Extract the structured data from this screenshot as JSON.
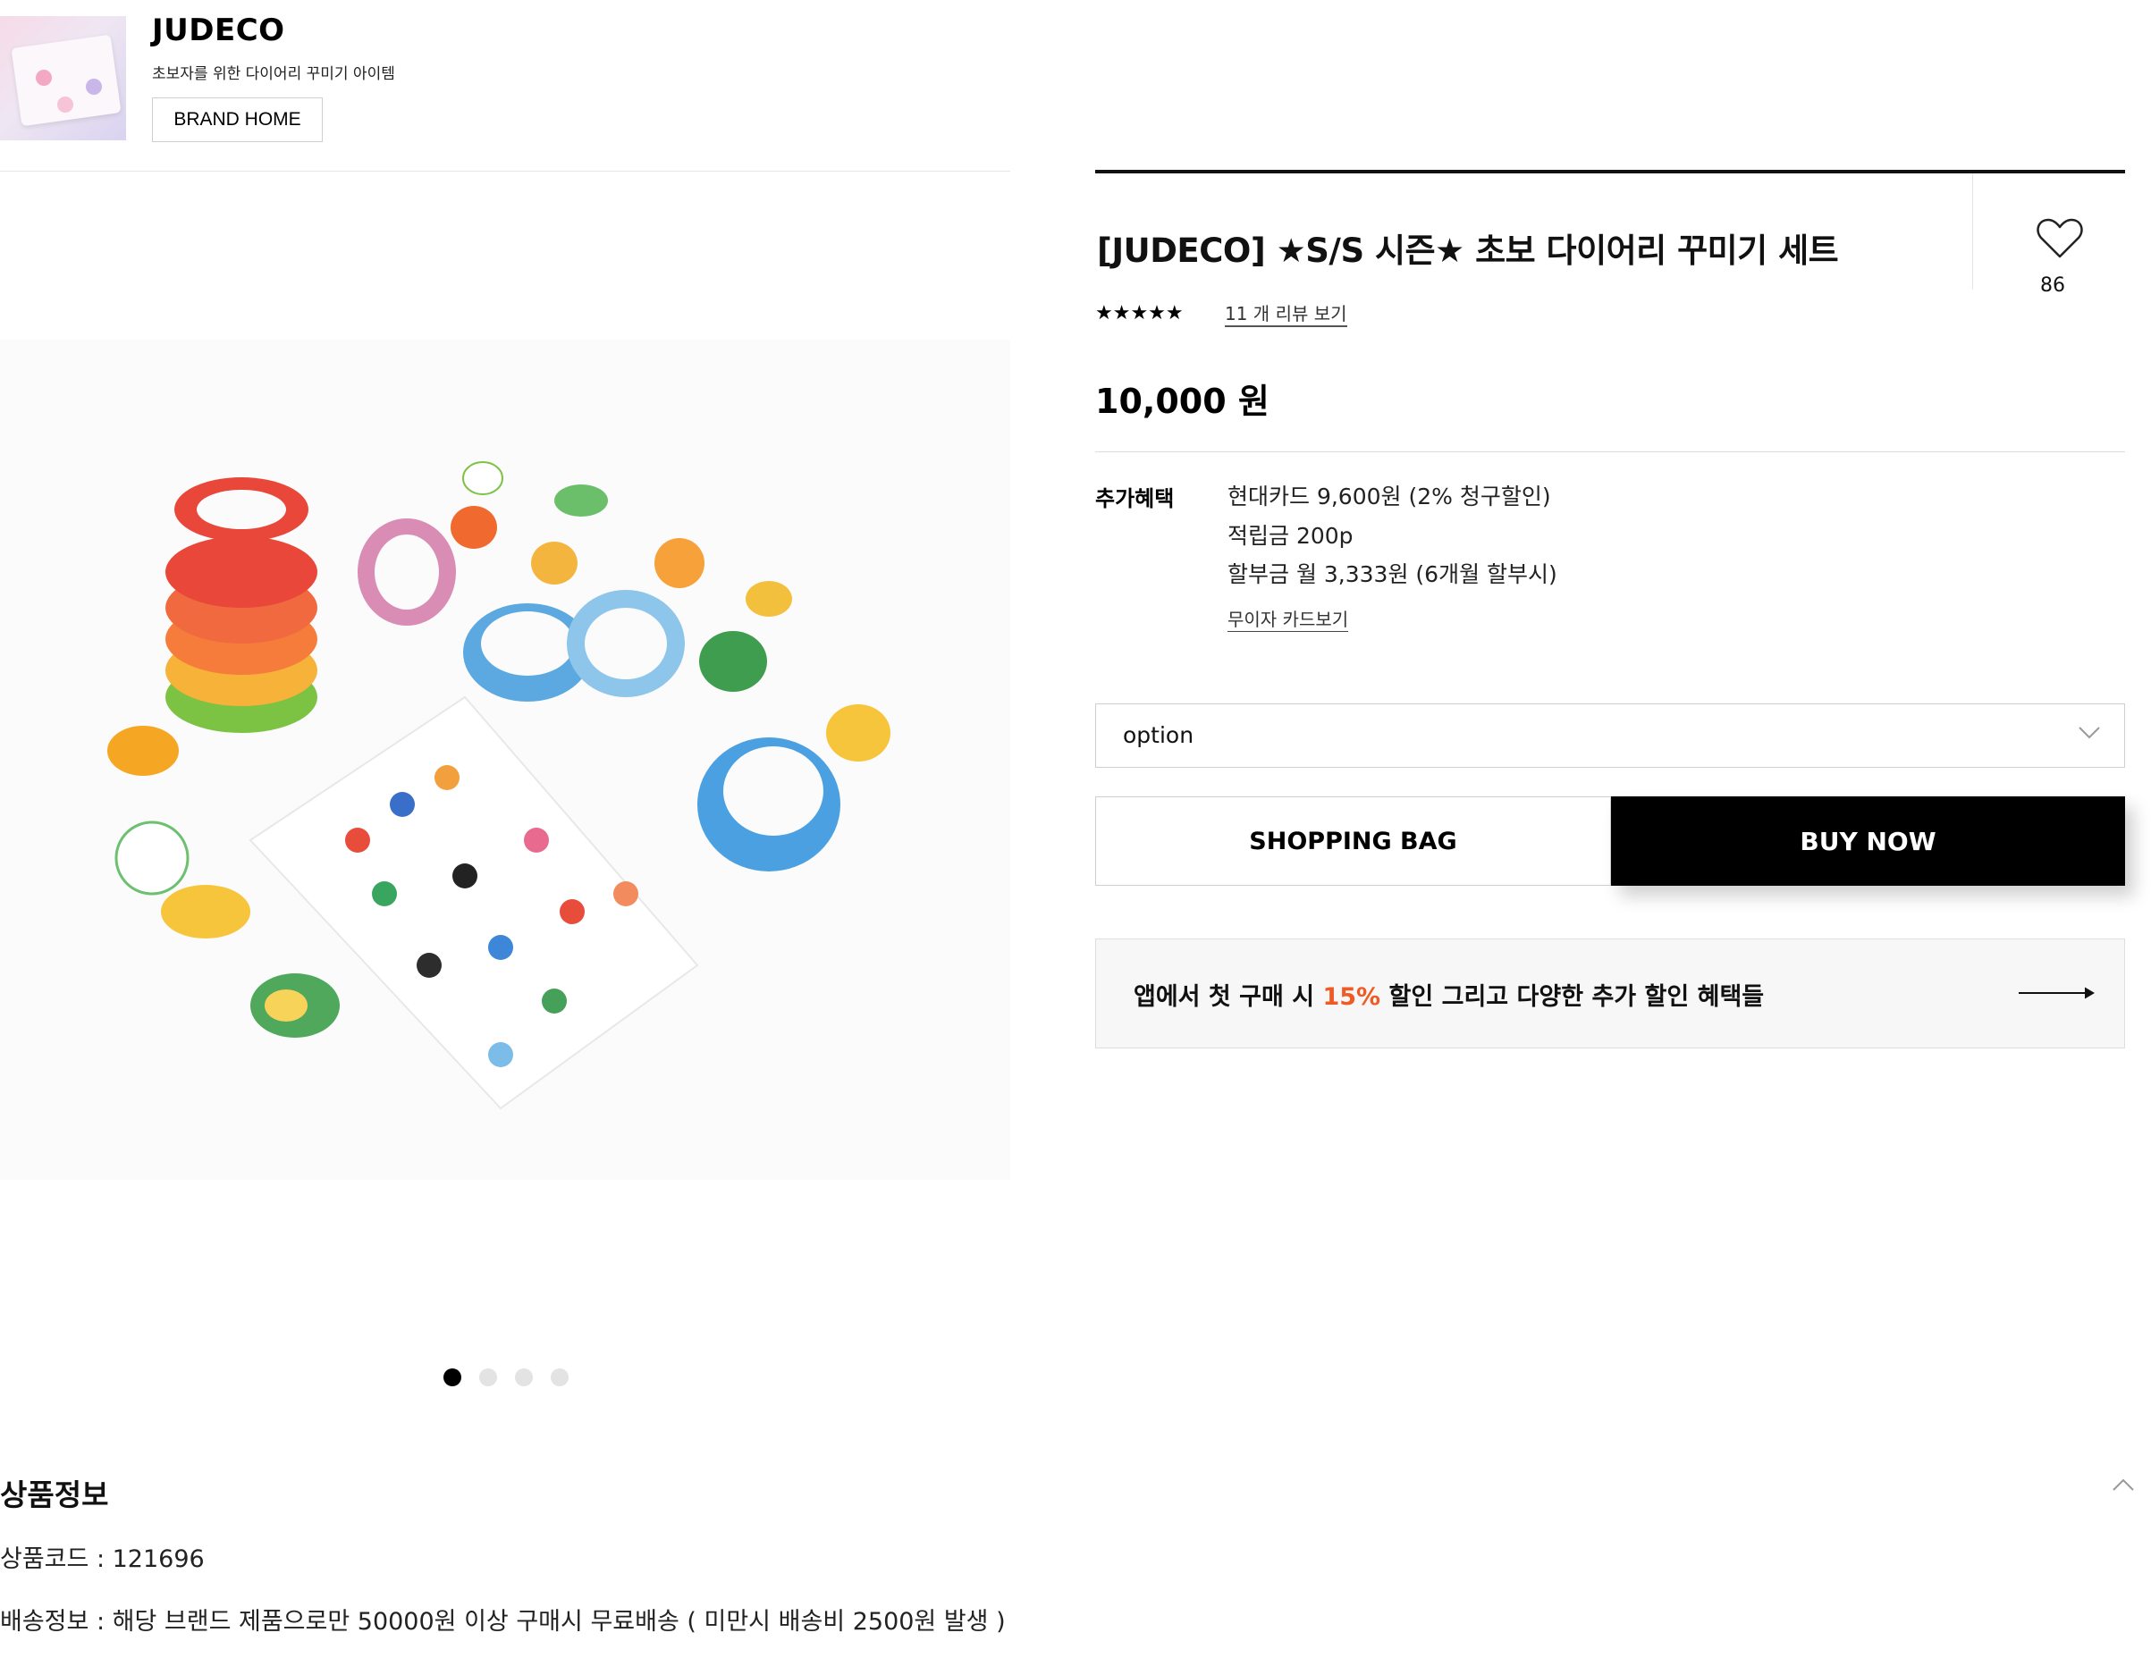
{
  "brand": {
    "name": "JUDECO",
    "description": "초보자를 위한 다이어리 꾸미기 아이템",
    "home_button": "BRAND HOME"
  },
  "product": {
    "title": "[JUDECO] ★S/S 시즌★ 초보 다이어리 꾸미기 세트",
    "rating": {
      "stars": 5,
      "display": "★★★★★"
    },
    "review_link": "11 개 리뷰 보기",
    "like_count": "86",
    "price": "10,000 원"
  },
  "benefits": {
    "label": "추가혜택",
    "lines": [
      "현대카드   9,600원 (2% 청구할인)",
      "적립금 200p",
      "할부금 월 3,333원 (6개월 할부시)"
    ],
    "card_link": "무이자 카드보기"
  },
  "option_select": {
    "value": "option"
  },
  "actions": {
    "shopping_bag": "SHOPPING BAG",
    "buy_now": "BUY NOW"
  },
  "app_banner": {
    "text_before": "앱에서 첫 구매 시 ",
    "highlight": "15%",
    "text_after": " 할인 그리고 다양한 추가 할인 혜택들",
    "highlight_color": "#f05a24"
  },
  "gallery": {
    "slide_count": 4,
    "active_index": 0
  },
  "product_info": {
    "title": "상품정보",
    "code": "상품코드 : 121696",
    "shipping": "배송정보 : 해당 브랜드 제품으로만 50000원 이상 구매시 무료배송 ( 미만시 배송비 2500원 발생 )"
  },
  "icons": [
    "heart-icon",
    "chevron-down-icon",
    "arrow-right-icon",
    "chevron-up-icon"
  ]
}
